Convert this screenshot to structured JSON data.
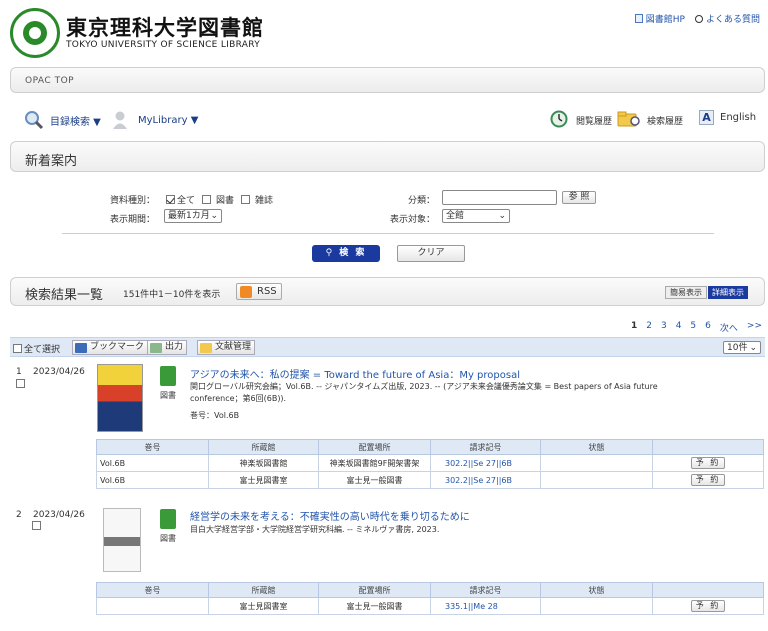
{
  "header": {
    "title_ja": "東京理科大学図書館",
    "title_en": "TOKYO UNIVERSITY OF SCIENCE LIBRARY",
    "links": [
      {
        "label": "図書館HP",
        "icon": "page-icon"
      },
      {
        "label": "よくある質問",
        "icon": "search-icon"
      }
    ]
  },
  "opac_bar": {
    "label": "OPAC TOP"
  },
  "nav": {
    "catalog_search": "目録検索 ▼",
    "mylibrary": "MyLibrary ▼",
    "browse_history": "閲覧履歴",
    "search_history": "検索履歴",
    "english": "English",
    "english_icon_letter": "A"
  },
  "section": {
    "title": "新着案内"
  },
  "form": {
    "material_type_label": "資料種別：",
    "opt_all": "全て",
    "opt_book": "図書",
    "opt_journal": "雑誌",
    "category_label": "分類：",
    "category_value": "",
    "browse_button": "参 照",
    "period_label": "表示期間：",
    "period_value": "最新1カ月",
    "target_label": "表示対象：",
    "target_value": "全館",
    "search_button": "検 索",
    "clear_button": "クリア"
  },
  "results": {
    "title": "検索結果一覧",
    "summary": "151件中1－10件を表示",
    "rss": "RSS",
    "simple_view": "簡易表示",
    "detail_view": "詳細表示",
    "pages": [
      "1",
      "2",
      "3",
      "4",
      "5",
      "6",
      "次へ",
      ">>"
    ],
    "toolbar": {
      "select_all": "全て選択",
      "bookmark": "ブックマーク",
      "output": "出力",
      "ref_manage": "文献管理",
      "per_page": "10件"
    },
    "table_headers": [
      "巻号",
      "所蔵館",
      "配置場所",
      "請求記号",
      "状態"
    ],
    "reserve_label": "予 約",
    "records": [
      {
        "num": "1",
        "date": "2023/04/26",
        "type": "図書",
        "title": "アジアの未来へ：私の提案 = Toward the future of Asia：My proposal",
        "meta1": "関口グローバル研究会編；Vol.6B. -- ジャパンタイムズ出版, 2023. -- (アジア未来会議優秀論文集 = Best papers of Asia future",
        "meta2": "conference；第6回(6B)).",
        "volume": "巻号：Vol.6B",
        "holdings": [
          {
            "vol": "Vol.6B",
            "library": "神楽坂図書館",
            "location": "神楽坂図書館9F開架書架",
            "call": "302.2||Se 27||6B",
            "status": ""
          },
          {
            "vol": "Vol.6B",
            "library": "富士見図書室",
            "location": "富士見一般図書",
            "call": "302.2||Se 27||6B",
            "status": ""
          }
        ]
      },
      {
        "num": "2",
        "date": "2023/04/26",
        "type": "図書",
        "title": "経営学の未来を考える：不確実性の高い時代を乗り切るために",
        "meta1": "目白大学経営学部・大学院経営学研究科編. -- ミネルヴァ書房, 2023.",
        "holdings": [
          {
            "vol": "",
            "library": "富士見図書室",
            "location": "富士見一般図書",
            "call": "335.1||Me 28",
            "status": ""
          }
        ]
      }
    ]
  },
  "colors": {
    "accent": "#1a3aa0",
    "link": "#2255aa",
    "logo_green": "#2a8a2a",
    "toolbar_bg": "#dfe9f6"
  }
}
